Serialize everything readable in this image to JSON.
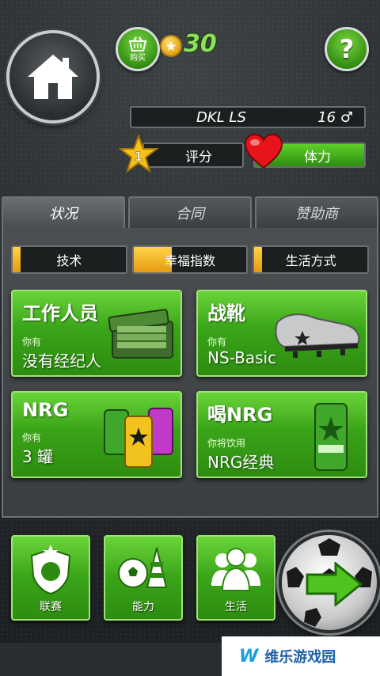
{
  "header": {
    "shop_label": "购买",
    "coins": "30",
    "help_label": "?"
  },
  "player": {
    "name": "DKL LS",
    "age": "16",
    "gender_symbol": "♂",
    "level": "1",
    "rating_label": "评分",
    "energy_label": "体力",
    "energy_level": 1.0
  },
  "tabs": [
    {
      "label": "状况",
      "active": true
    },
    {
      "label": "合同",
      "active": false
    },
    {
      "label": "赞助商",
      "active": false
    }
  ],
  "substats": [
    {
      "label": "技术",
      "level": 0.07
    },
    {
      "label": "幸福指数",
      "level": 0.34
    },
    {
      "label": "生活方式",
      "level": 0.07
    }
  ],
  "cards": [
    {
      "title": "工作人员",
      "sub": "你有",
      "value": "没有经纪人",
      "icon": "briefcase-money-icon"
    },
    {
      "title": "战靴",
      "sub": "你有",
      "value": "NS-Basic",
      "icon": "soccer-boot-icon"
    },
    {
      "title": "NRG",
      "sub": "你有",
      "value": "3 罐",
      "icon": "energy-cans-icon"
    },
    {
      "title": "喝NRG",
      "sub": "你将饮用",
      "value": "NRG经典",
      "icon": "energy-can-icon"
    }
  ],
  "bottom_nav": [
    {
      "label": "联赛",
      "icon": "league-shield-icon"
    },
    {
      "label": "能力",
      "icon": "training-ball-cone-icon"
    },
    {
      "label": "生活",
      "icon": "people-icon"
    }
  ],
  "watermark": {
    "logo": "W",
    "text": "维乐游戏园"
  },
  "colors": {
    "accent_green": "#3aa419",
    "bar_yellow": "#ffd34a",
    "coin_text": "#8de05a"
  }
}
